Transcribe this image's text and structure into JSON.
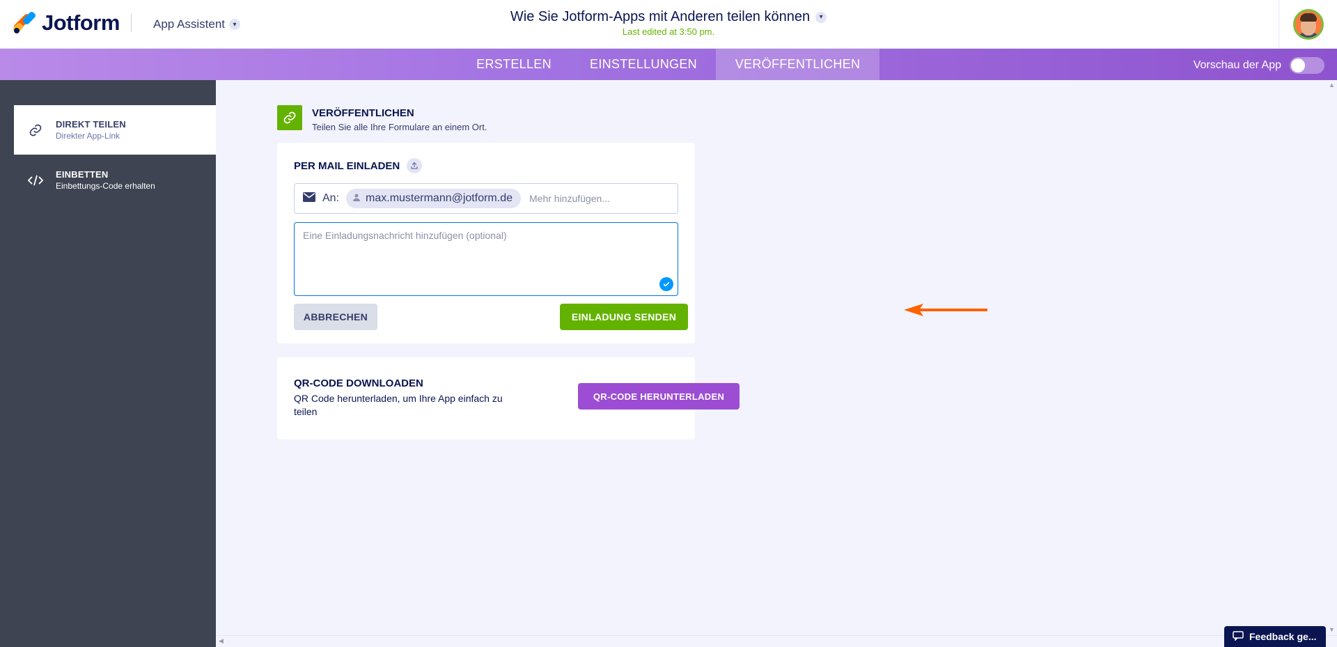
{
  "header": {
    "logo_text": "Jotform",
    "app_assistant_label": "App Assistent",
    "doc_title": "Wie Sie Jotform-Apps mit Anderen teilen können",
    "last_edited": "Last edited at 3:50 pm."
  },
  "nav": {
    "tabs": [
      {
        "label": "ERSTELLEN"
      },
      {
        "label": "EINSTELLUNGEN"
      },
      {
        "label": "VERÖFFENTLICHEN"
      }
    ],
    "preview_label": "Vorschau der App"
  },
  "sidebar": {
    "items": [
      {
        "title": "DIREKT TEILEN",
        "subtitle": "Direkter App-Link"
      },
      {
        "title": "EINBETTEN",
        "subtitle": "Einbettungs-Code erhalten"
      }
    ]
  },
  "publish": {
    "title": "VERÖFFENTLICHEN",
    "subtitle": "Teilen Sie alle Ihre Formulare an einem Ort."
  },
  "mail": {
    "title": "PER MAIL EINLADEN",
    "to_label": "An:",
    "recipient": "max.mustermann@jotform.de",
    "more_placeholder": "Mehr hinzufügen...",
    "message_placeholder": "Eine Einladungsnachricht hinzufügen (optional)",
    "cancel_label": "ABBRECHEN",
    "send_label": "EINLADUNG SENDEN"
  },
  "qr": {
    "title": "QR-CODE DOWNLOADEN",
    "subtitle": "QR Code herunterladen, um Ihre App einfach zu teilen",
    "button_label": "QR-CODE HERUNTERLADEN"
  },
  "feedback": {
    "label": "Feedback ge..."
  },
  "colors": {
    "accent_green": "#64b200",
    "accent_purple": "#9c4dd3",
    "sidebar_bg": "#3e4452",
    "arrow": "#ff6100"
  }
}
